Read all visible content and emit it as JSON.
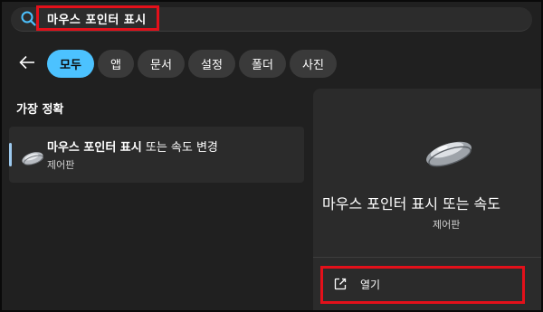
{
  "search": {
    "query": "마우스 포인터 표시"
  },
  "filters": [
    {
      "label": "모두",
      "active": true
    },
    {
      "label": "앱",
      "active": false
    },
    {
      "label": "문서",
      "active": false
    },
    {
      "label": "설정",
      "active": false
    },
    {
      "label": "폴더",
      "active": false
    },
    {
      "label": "사진",
      "active": false
    }
  ],
  "results": {
    "section_title": "가장 정확",
    "best_match": {
      "title_bold": "마우스 포인터 표시",
      "title_rest": " 또는 속도 변경",
      "subtitle": "제어판",
      "icon": "mouse-icon"
    }
  },
  "detail": {
    "title": "마우스 포인터 표시 또는 속도",
    "subtitle": "제어판",
    "icon": "mouse-icon",
    "open_label": "열기",
    "open_icon": "open-external-icon"
  },
  "colors": {
    "accent": "#4cc2ff",
    "highlight_box": "#e3101a",
    "background": "#202020"
  }
}
